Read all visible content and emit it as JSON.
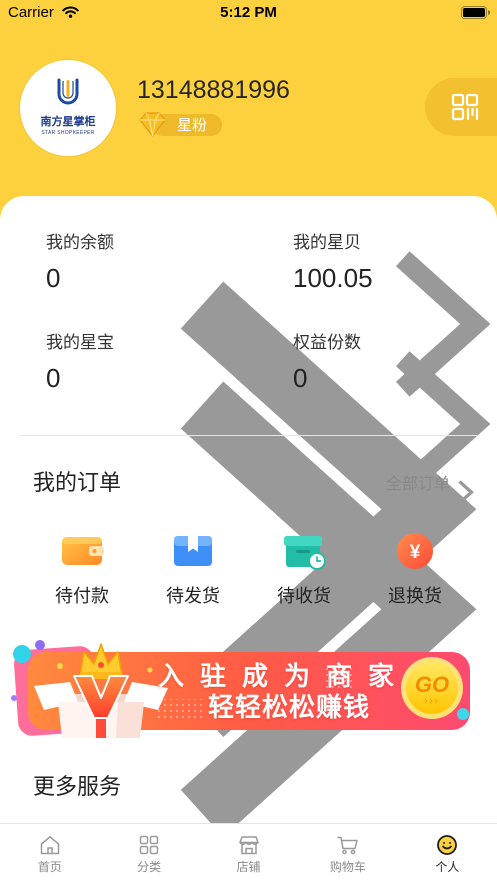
{
  "status_bar": {
    "carrier": "Carrier",
    "time": "5:12 PM"
  },
  "profile": {
    "logo_title": "南方星掌柜",
    "logo_subtitle": "STAR SHOPKEEPER",
    "phone": "13148881996",
    "level_badge": "星粉"
  },
  "stats": [
    {
      "label": "我的余额",
      "value": "0"
    },
    {
      "label": "我的星贝",
      "value": "100.05"
    },
    {
      "label": "我的星宝",
      "value": "0"
    },
    {
      "label": "权益份数",
      "value": "0"
    }
  ],
  "orders": {
    "title": "我的订单",
    "view_all_label": "全部订单",
    "items": [
      {
        "label": "待付款",
        "icon": "wallet-icon"
      },
      {
        "label": "待发货",
        "icon": "package-icon"
      },
      {
        "label": "待收货",
        "icon": "delivery-box-icon"
      },
      {
        "label": "退换货",
        "icon": "refund-icon",
        "glyph": "¥"
      }
    ]
  },
  "banner": {
    "line1": "入驻成为商家",
    "line2": "轻轻松松赚钱",
    "button": "GO"
  },
  "more_services": {
    "title": "更多服务"
  },
  "tabbar": {
    "items": [
      {
        "label": "首页",
        "icon": "home-icon"
      },
      {
        "label": "分类",
        "icon": "category-icon"
      },
      {
        "label": "店铺",
        "icon": "store-icon"
      },
      {
        "label": "购物车",
        "icon": "cart-icon"
      },
      {
        "label": "个人",
        "icon": "profile-icon",
        "active": true
      }
    ]
  },
  "colors": {
    "brand_yellow": "#FDD13E",
    "badge_gold": "#EFB92C",
    "qr_button": "#F3C12F",
    "text_primary": "#222222",
    "text_secondary": "#888888",
    "tab_inactive": "#8A8A8A"
  }
}
